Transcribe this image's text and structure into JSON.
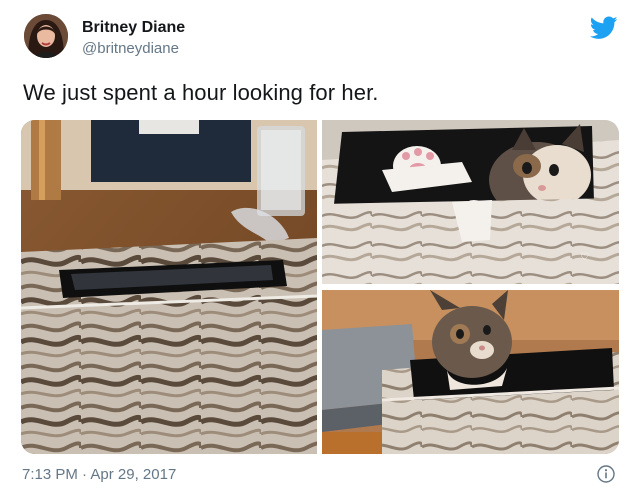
{
  "tweet": {
    "author_name": "Britney Diane",
    "author_handle": "@britneydiane",
    "text": "We just spent a hour looking for her.",
    "time": "7:13 PM",
    "separator": "·",
    "date": "Apr 29, 2017"
  },
  "icons": {
    "logo": "twitter-bird-icon",
    "info": "info-icon"
  },
  "colors": {
    "brand": "#1da1f2",
    "text_primary": "#14171a",
    "text_secondary": "#657786"
  }
}
